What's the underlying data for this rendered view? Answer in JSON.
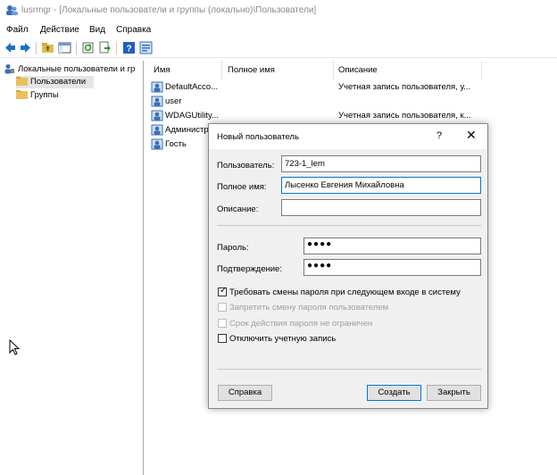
{
  "window": {
    "title": "lusrmgr - [Локальные пользователи и группы (локально)\\Пользователи]"
  },
  "menu": [
    "Файл",
    "Действие",
    "Вид",
    "Справка"
  ],
  "toolbar": {
    "icons": [
      "back-arrow",
      "forward-arrow",
      "up-folder",
      "show-hide-tree",
      "refresh",
      "export-list",
      "help",
      "properties"
    ]
  },
  "tree": {
    "root": "Локальные пользователи и гр",
    "items": [
      "Пользователи",
      "Группы"
    ],
    "selected": "Пользователи"
  },
  "list": {
    "columns": [
      "Имя",
      "Полное имя",
      "Описание"
    ],
    "rows": [
      {
        "name": "DefaultAcco...",
        "full": "",
        "desc": "Учетная запись пользователя, у..."
      },
      {
        "name": "user",
        "full": "",
        "desc": ""
      },
      {
        "name": "WDAGUtility...",
        "full": "",
        "desc": "Учетная запись пользователя, к..."
      },
      {
        "name": "Администр",
        "full": "",
        "desc": ""
      },
      {
        "name": "Гость",
        "full": "",
        "desc": ""
      }
    ]
  },
  "dialog": {
    "title": "Новый пользователь",
    "help_glyph": "?",
    "close_glyph": "✕",
    "username_label": "Пользователь:",
    "username_value": "723-1_lem",
    "fullname_label": "Полное имя:",
    "fullname_value": "Лысенко Евгения Михайловна",
    "description_label": "Описание:",
    "description_value": "",
    "password_label": "Пароль:",
    "password_value": "●●●●",
    "confirm_label": "Подтверждение:",
    "confirm_value": "●●●●",
    "options": [
      {
        "label": "Требовать смены пароля при следующем входе в систему",
        "checked": true,
        "enabled": true
      },
      {
        "label": "Запретить смену пароля пользователем",
        "checked": false,
        "enabled": false
      },
      {
        "label": "Срок действия пароля не ограничен",
        "checked": false,
        "enabled": false
      },
      {
        "label": "Отключить учетную запись",
        "checked": false,
        "enabled": true
      }
    ],
    "help_button": "Справка",
    "create_button": "Создать",
    "close_button": "Закрыть"
  },
  "colors": {
    "accent": "#0078d7",
    "selection": "#e5e5e5",
    "dialog_bg": "#f0f0f0"
  }
}
